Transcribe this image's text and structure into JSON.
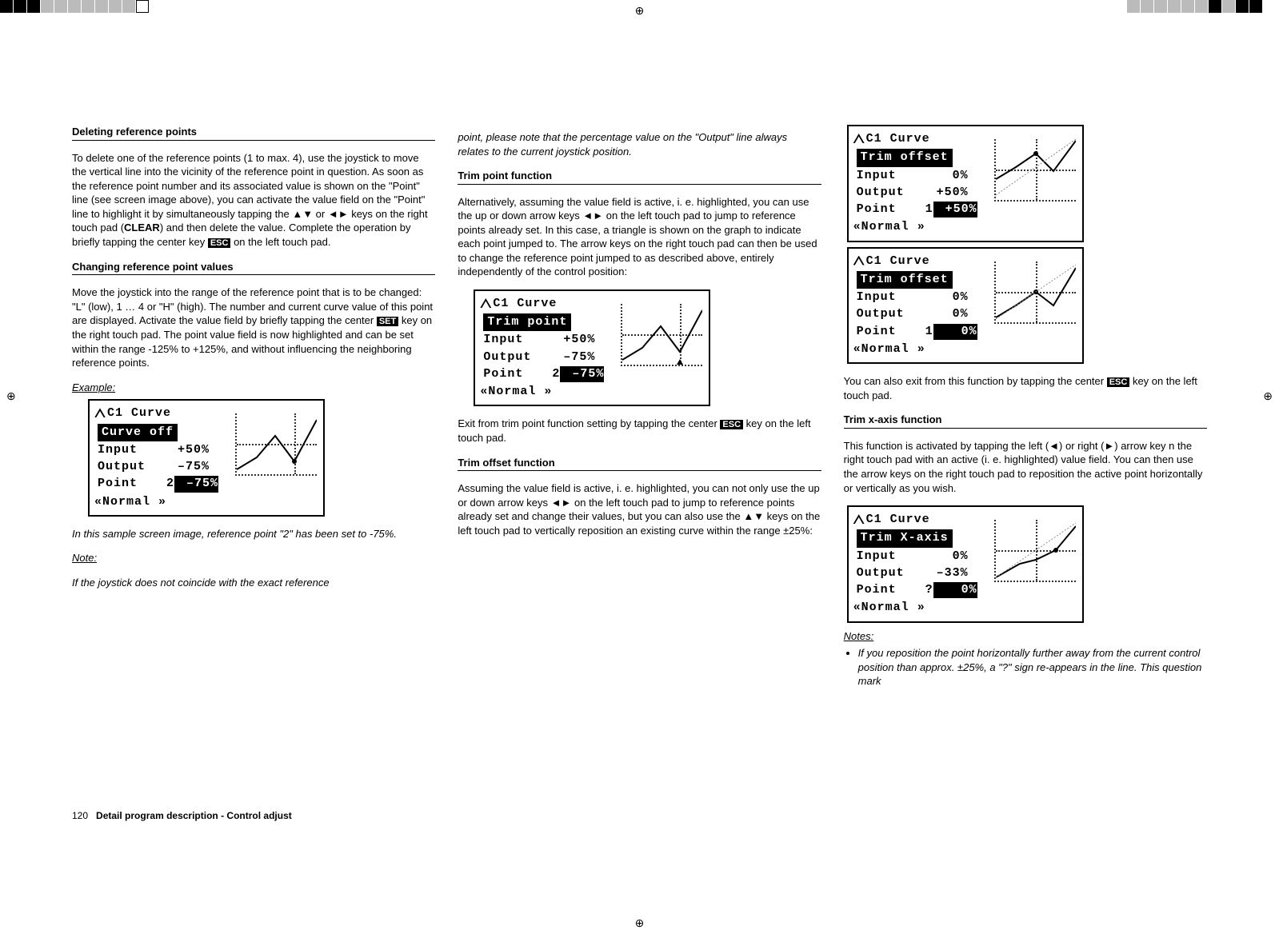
{
  "marks": {
    "crosshair": "⊕"
  },
  "footer": {
    "page": "120",
    "title": "Detail program description - Control adjust"
  },
  "col1": {
    "h1": "Deleting reference points",
    "p1a": "To delete one of the reference points (1 to max. 4), use the joystick to move the vertical line into the vicinity of the reference point in question. As soon as the reference point number and its associated value is shown on the \"Point\" line (see screen image above), you can activate the value field on the \"Point\" line to highlight it by simultaneously tapping the ▲▼ or ◄► keys on the right touch pad (",
    "p1b": "CLEAR",
    "p1c": ") and then delete the value. Complete the operation by briefly tapping the center key ",
    "p1esc": "ESC",
    "p1d": " on the left touch pad.",
    "h2": "Changing reference point values",
    "p2a": "Move the joystick into the range of the reference point that is to be changed: \"L\" (low), 1 … 4 or \"H\" (high). The number and current curve value of this point are displayed. Activate the value field by briefly tapping the center ",
    "p2set": "SET",
    "p2b": " key on the right touch pad. The point value field is now highlighted and can be set within the range -125% to +125%, and without influencing the neighboring reference points.",
    "ex": "Example:",
    "cap": "In this sample screen image, reference point \"2\" has been set to -75%.",
    "noteh": "Note:",
    "note": "If the joystick does not coincide with the exact reference"
  },
  "col2": {
    "p1": "point, please note that the percentage value on the \"Output\" line always relates to the current joystick position.",
    "h1": "Trim point function",
    "p2": "Alternatively, assuming the value field is active, i. e. highlighted, you can use the up or down arrow keys ◄► on the left touch pad to jump to reference points already set. In this case, a triangle is shown on the graph to indicate each point jumped to. The arrow keys on the right touch pad can then be used to change the reference point jumped to as described above, entirely independently of the control position:",
    "p3a": "Exit from trim point function setting by tapping the center ",
    "p3esc": "ESC",
    "p3b": " key on the left touch pad.",
    "h2": "Trim offset function",
    "p4": "Assuming the value field is active, i. e. highlighted, you can not only use the up or down arrow keys ◄► on the left touch pad to jump to reference points already set and change their values, but you can also use the ▲▼ keys on the left touch pad to vertically reposition an existing curve within the range ±25%:"
  },
  "col3": {
    "p1a": "You can also exit from this function by tapping the center ",
    "p1esc": "ESC",
    "p1b": " key on the left touch pad.",
    "h1": "Trim x-axis function",
    "p2": "This function is activated by tapping the left (◄) or right (►) arrow key n the right touch pad with an active (i. e. highlighted) value field. You can then use the arrow keys on the right touch pad to reposition the active point horizontally or vertically as you wish.",
    "noteh": "Notes:",
    "note1": "If you reposition the point horizontally further away from the current control position than approx. ±25%, a \"?\" sign re-appears in the line. This question mark"
  },
  "lcd1": {
    "title": "C1  Curve",
    "sub": "Curve off",
    "in_l": "Input",
    "in_v": "+50%",
    "out_l": "Output",
    "out_v": "–75%",
    "pt_l": "Point",
    "pt_n": "2",
    "pt_v": "–75%",
    "nav": "Normal"
  },
  "lcd2": {
    "title": "C1  Curve",
    "sub": "Trim point",
    "in_l": "Input",
    "in_v": "+50%",
    "out_l": "Output",
    "out_v": "–75%",
    "pt_l": "Point",
    "pt_n": "2",
    "pt_v": "–75%",
    "nav": "Normal"
  },
  "lcd3": {
    "title": "C1  Curve",
    "sub": "Trim offset",
    "in_l": "Input",
    "in_v": "0%",
    "out_l": "Output",
    "out_v": "+50%",
    "pt_l": "Point",
    "pt_n": "1",
    "pt_v": "+50%",
    "nav": "Normal"
  },
  "lcd4": {
    "title": "C1  Curve",
    "sub": "Trim offset",
    "in_l": "Input",
    "in_v": "0%",
    "out_l": "Output",
    "out_v": "0%",
    "pt_l": "Point",
    "pt_n": "1",
    "pt_v": "0%",
    "nav": "Normal"
  },
  "lcd5": {
    "title": "C1  Curve",
    "sub": "Trim X-axis",
    "in_l": "Input",
    "in_v": "0%",
    "out_l": "Output",
    "out_v": "–33%",
    "pt_l": "Point",
    "pt_n": "?",
    "pt_v": "0%",
    "nav": "Normal"
  }
}
